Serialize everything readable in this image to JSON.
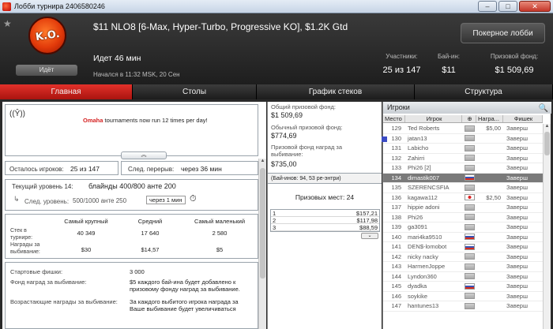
{
  "window": {
    "title": "Лобби турнира 2406580246",
    "min": "–",
    "max": "□",
    "close": "✕"
  },
  "header": {
    "logo_text": "K.O.",
    "badge": "Идёт",
    "tournament_name": "$11 NLO8 [6-Max, Hyper-Turbo, Progressive KO], $1.2K Gtd",
    "status": "Идет 46 мин",
    "started": "Начался в 11:32 MSK, 20 Сен",
    "lobby_button": "Покерное лобби",
    "stats": [
      {
        "label": "Участники:",
        "value": "25 из 147"
      },
      {
        "label": "Бай-ин:",
        "value": "$11"
      },
      {
        "label": "Призовой фонд:",
        "value": "$1 509,69"
      }
    ]
  },
  "tabs": [
    "Главная",
    "Столы",
    "График стеков",
    "Структура"
  ],
  "news": {
    "highlight": "Omaha",
    "text": " tournaments now run 12 times per day!"
  },
  "players_left": {
    "label": "Осталось игроков:",
    "value": "25 из 147"
  },
  "next_break": {
    "label": "След. перерыв:",
    "value": "через 36 мин"
  },
  "level": {
    "label": "Текущий уровень 14:",
    "value": "блайнды 400/800 анте 200",
    "next_label": "След. уровень:",
    "next_value": "500/1000 анте 250",
    "next_in": "через 1 мин"
  },
  "stacks": {
    "headers": [
      "Самый крупный",
      "Средний",
      "Самый маленький"
    ],
    "stack_label": "Стек в турнире:",
    "stack_values": [
      "40 349",
      "17 640",
      "2 580"
    ],
    "bounty_label": "Награды за выбивание:",
    "bounty_values": [
      "$30",
      "$14,57",
      "$5"
    ]
  },
  "info": {
    "chips_label": "Стартовые фишки:",
    "chips_value": "3 000",
    "bounty_fund_label": "Фонд наград за выбивание:",
    "bounty_fund_value": "$5 каждого бай-ина будет добавлено к призовому фонду наград за выбивание.",
    "progressive_label": "Возрастающие награды за выбивание:",
    "progressive_value": "За каждого выбитого игрока награда за Ваше выбивание будет увеличиваться"
  },
  "prize": {
    "total_label": "Общий призовой фонд:",
    "total_value": "$1 509,69",
    "regular_label": "Обычный призовой фонд:",
    "regular_value": "$774,69",
    "bounty_label": "Призовой фонд наград за выбивание:",
    "bounty_value": "$735,00",
    "entries": "(Бай-инов: 94, 53 ре-энтри)",
    "places_label": "Призовых мест: 24",
    "rows": [
      {
        "place": "1",
        "amount": "$157,21"
      },
      {
        "place": "2",
        "amount": "$117,98"
      },
      {
        "place": "3",
        "amount": "$88,59"
      }
    ]
  },
  "players": {
    "title": "Игроки",
    "columns": [
      "Место",
      "Игрок",
      "",
      "Награ...",
      "Фишек"
    ],
    "rows": [
      {
        "place": "129",
        "name": "Ted Roberts",
        "bounty": "$5,00",
        "chips": "Заверш",
        "flag": "gray"
      },
      {
        "place": "130",
        "name": "jatan13",
        "bounty": "",
        "chips": "Заверш",
        "flag": "gray",
        "marker": true
      },
      {
        "place": "131",
        "name": "Labicho",
        "bounty": "",
        "chips": "Заверш",
        "flag": "gray"
      },
      {
        "place": "132",
        "name": "Zahirri",
        "bounty": "",
        "chips": "Заверш",
        "flag": "gray"
      },
      {
        "place": "133",
        "name": "Phi26 [2]",
        "bounty": "",
        "chips": "Заверш",
        "flag": "gray"
      },
      {
        "place": "134",
        "name": "dimastik007",
        "bounty": "",
        "chips": "Заверш",
        "flag": "ru",
        "selected": true
      },
      {
        "place": "135",
        "name": "SZERENCSFIA",
        "bounty": "",
        "chips": "Заверш",
        "flag": "gray"
      },
      {
        "place": "136",
        "name": "kagawa112",
        "bounty": "$2,50",
        "chips": "Заверш",
        "flag": "jp"
      },
      {
        "place": "137",
        "name": "hippie adoni",
        "bounty": "",
        "chips": "Заверш",
        "flag": "gray"
      },
      {
        "place": "138",
        "name": "Phi26",
        "bounty": "",
        "chips": "Заверш",
        "flag": "gray"
      },
      {
        "place": "139",
        "name": "ga3091",
        "bounty": "",
        "chips": "Заверш",
        "flag": "gray"
      },
      {
        "place": "140",
        "name": "mari4ka9510",
        "bounty": "",
        "chips": "Заверш",
        "flag": "ru"
      },
      {
        "place": "141",
        "name": "DEN$-lomobot",
        "bounty": "",
        "chips": "Заверш",
        "flag": "ru"
      },
      {
        "place": "142",
        "name": "nicky nacky",
        "bounty": "",
        "chips": "Заверш",
        "flag": "gray"
      },
      {
        "place": "143",
        "name": "HarmenJoppe",
        "bounty": "",
        "chips": "Заверш",
        "flag": "gray"
      },
      {
        "place": "144",
        "name": "Lyndon360",
        "bounty": "",
        "chips": "Заверш",
        "flag": "gray"
      },
      {
        "place": "145",
        "name": "dyadka",
        "bounty": "",
        "chips": "Заверш",
        "flag": "ru"
      },
      {
        "place": "146",
        "name": "soykike",
        "bounty": "",
        "chips": "Заверш",
        "flag": "gray"
      },
      {
        "place": "147",
        "name": "hantunes13",
        "bounty": "",
        "chips": "Заверш",
        "flag": "gray"
      }
    ]
  }
}
